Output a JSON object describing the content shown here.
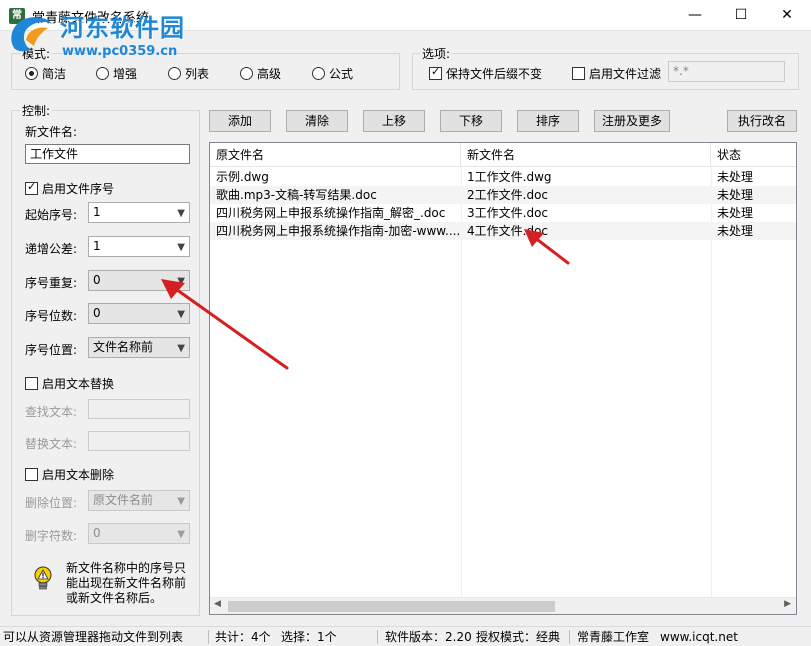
{
  "window": {
    "title": "常青藤文件改名系统",
    "min_glyph": "—",
    "max_glyph": "☐",
    "close_glyph": "✕"
  },
  "watermark": {
    "main": "河东软件园",
    "sub": "www.pc0359.cn"
  },
  "mode": {
    "group_label": "模式:",
    "options": [
      "简洁",
      "增强",
      "列表",
      "高级",
      "公式"
    ],
    "selected": "简洁"
  },
  "options": {
    "group_label": "选项:",
    "keep_suffix_label": "保持文件后缀不变",
    "keep_suffix_checked": true,
    "filter_label": "启用文件过滤",
    "filter_checked": false,
    "filter_value": "*.*"
  },
  "control": {
    "group_label": "控制:",
    "new_name_label": "新文件名:",
    "new_name_value": "工作文件",
    "enable_seq_label": "启用文件序号",
    "enable_seq_checked": true,
    "start_label": "起始序号:",
    "start_value": "1",
    "step_label": "递增公差:",
    "step_value": "1",
    "repeat_label": "序号重复:",
    "repeat_value": "0",
    "digits_label": "序号位数:",
    "digits_value": "0",
    "position_label": "序号位置:",
    "position_value": "文件名称前",
    "enable_replace_label": "启用文本替换",
    "enable_replace_checked": false,
    "find_label": "查找文本:",
    "find_value": "",
    "replace_label": "替换文本:",
    "replace_value": "",
    "enable_delete_label": "启用文本删除",
    "enable_delete_checked": false,
    "delete_pos_label": "删除位置:",
    "delete_pos_value": "原文件名前",
    "delete_count_label": "删字符数:",
    "delete_count_value": "0",
    "tip_line1": "新文件名称中的序号只",
    "tip_line2": "能出现在新文件名称前",
    "tip_line3": "或新文件名称后。"
  },
  "toolbar": {
    "add": "添加",
    "clear": "清除",
    "up": "上移",
    "down": "下移",
    "sort": "排序",
    "register": "注册及更多",
    "execute": "执行改名"
  },
  "table": {
    "columns": [
      "原文件名",
      "新文件名",
      "状态"
    ],
    "rows": [
      {
        "orig": "示例.dwg",
        "new": "1工作文件.dwg",
        "status": "未处理"
      },
      {
        "orig": "歌曲.mp3-文稿-转写结果.doc",
        "new": "2工作文件.doc",
        "status": "未处理"
      },
      {
        "orig": "四川税务网上申报系统操作指南_解密_.doc",
        "new": "3工作文件.doc",
        "status": "未处理"
      },
      {
        "orig": "四川税务网上申报系统操作指南-加密-www....",
        "new": "4工作文件.doc",
        "status": "未处理"
      }
    ]
  },
  "status": {
    "hint": "可以从资源管理器拖动文件到列表",
    "total": "共计：4个",
    "selected": "选择：1个",
    "version": "软件版本：2.20",
    "license": "授权模式：经典",
    "studio": "常青藤工作室",
    "site": "www.icqt.net"
  },
  "icons": [
    "app-icon",
    "warning-bulb-icon",
    "chevron-down-icon",
    "scroll-left-icon",
    "scroll-right-icon"
  ],
  "colors": {
    "accent_arrow": "#d42020",
    "watermark_blue": "#1e88d6"
  }
}
